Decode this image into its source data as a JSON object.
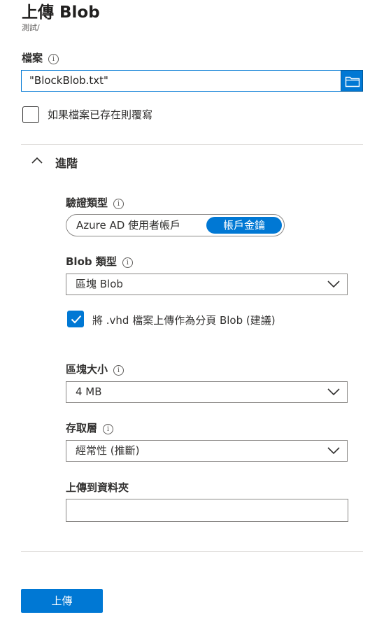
{
  "header": {
    "title": "上傳 Blob",
    "breadcrumb": "測試/"
  },
  "file": {
    "label": "檔案",
    "value": "\"BlockBlob.txt\"",
    "browse_icon": "folder-icon"
  },
  "overwrite": {
    "label": "如果檔案已存在則覆寫",
    "checked": false
  },
  "advanced": {
    "label": "進階",
    "expanded": true
  },
  "auth_type": {
    "label": "驗證類型",
    "options": [
      "Azure AD 使用者帳戶",
      "帳戶金鑰"
    ],
    "selected": "帳戶金鑰"
  },
  "blob_type": {
    "label": "Blob 類型",
    "value": "區塊 Blob"
  },
  "vhd_page_blob": {
    "label": "將 .vhd 檔案上傳作為分頁 Blob (建議)",
    "checked": true
  },
  "block_size": {
    "label": "區塊大小",
    "value": "4 MB"
  },
  "access_tier": {
    "label": "存取層",
    "value": "經常性 (推斷)"
  },
  "upload_folder": {
    "label": "上傳到資料夾",
    "value": ""
  },
  "upload_button": {
    "label": "上傳"
  },
  "colors": {
    "accent": "#0078d4",
    "border": "#8a8886",
    "divider": "#e1dfdd"
  }
}
